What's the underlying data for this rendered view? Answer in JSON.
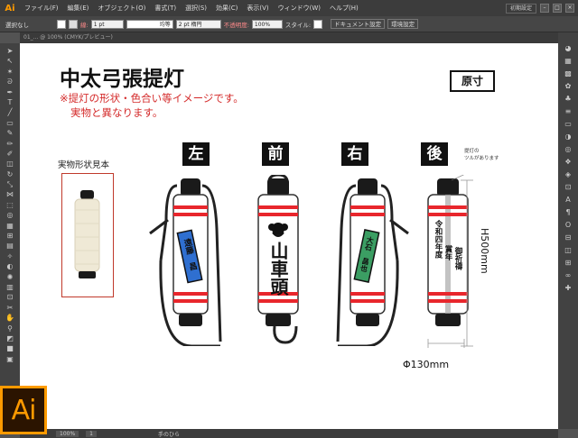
{
  "menubar": {
    "logo": "Ai",
    "items": [
      "ファイル(F)",
      "編集(E)",
      "オブジェクト(O)",
      "書式(T)",
      "選択(S)",
      "効果(C)",
      "表示(V)",
      "ウィンドウ(W)",
      "ヘルプ(H)"
    ],
    "workspace": "初期設定"
  },
  "control": {
    "selection": "選択なし",
    "stroke_label": "線:",
    "stroke_value": "1 pt",
    "uniform_label": "均等",
    "brush_value": "2 pt 楕円",
    "opacity_label": "不透明度:",
    "opacity_value": "100%",
    "style_label": "スタイル:",
    "doc_settings": "ドキュメント設定",
    "env_settings": "環境設定"
  },
  "tab": {
    "label": "01_... @ 100% (CMYK/プレビュー)"
  },
  "status": {
    "zoom": "100%",
    "page": "1",
    "tool": "手のひら"
  },
  "badge": {
    "text": "Ai"
  },
  "artboard": {
    "title": "中太弓張提灯",
    "note_line1": "※提灯の形状・色合い等イメージです。",
    "note_line2": "実物と異なります。",
    "actual_size": "原寸",
    "sample_label": "実物形状見本",
    "views": {
      "left": "左",
      "front": "前",
      "right": "右",
      "back": "後"
    },
    "tsuru_note_1": "提灯の",
    "tsuru_note_2": "ツルがあります",
    "height_label": "H500mm",
    "diameter_label": "Φ130mm",
    "left_name": "遠藤　昌",
    "front_text": "山車頭",
    "right_name": "大石　昌也",
    "back_col1": "令和四年度",
    "back_col2": "賞年",
    "back_col3": "御祈禱"
  },
  "colors": {
    "accent_red": "#d42a2a",
    "ai_orange": "#ff9a00",
    "band_red": "#e8262c",
    "left_tag_blue": "#2f6fd0",
    "right_tag_green": "#3b9e63"
  }
}
